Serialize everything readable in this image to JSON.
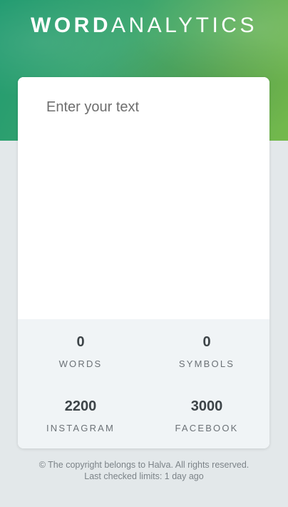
{
  "header": {
    "logo_bold": "WORD",
    "logo_light": "ANALYTICS"
  },
  "editor": {
    "placeholder": "Enter your text",
    "value": ""
  },
  "stats": [
    {
      "value": "0",
      "label": "WORDS"
    },
    {
      "value": "0",
      "label": "SYMBOLS"
    },
    {
      "value": "2200",
      "label": "INSTAGRAM"
    },
    {
      "value": "3000",
      "label": "FACEBOOK"
    }
  ],
  "footer": {
    "copyright": "© The copyright belongs to Halva. All rights reserved.",
    "last_checked": "Last checked limits: 1 day ago"
  },
  "colors": {
    "hero_start": "#1f9a6f",
    "hero_end": "#74b94b",
    "page_bg": "#e3e8ea",
    "stats_bg": "#f0f4f6"
  }
}
